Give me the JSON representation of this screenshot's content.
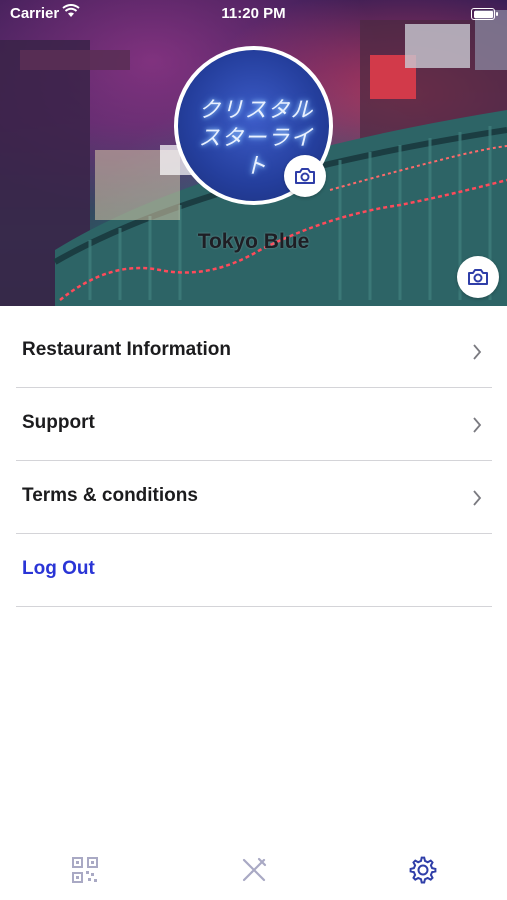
{
  "status_bar": {
    "carrier": "Carrier",
    "time": "11:20 PM"
  },
  "profile": {
    "name": "Tokyo Blue",
    "avatar_sign_text": "クリスタル スターライト"
  },
  "menu": {
    "items": [
      {
        "label": "Restaurant Information",
        "icon": "chevron-right-icon"
      },
      {
        "label": "Support",
        "icon": "chevron-right-icon"
      },
      {
        "label": "Terms & conditions",
        "icon": "chevron-right-icon"
      }
    ],
    "logout_label": "Log Out"
  },
  "tabbar": {
    "tabs": [
      {
        "icon": "qr-code-icon",
        "active": false
      },
      {
        "icon": "fork-knife-icon",
        "active": false
      },
      {
        "icon": "gear-icon",
        "active": true
      }
    ]
  },
  "colors": {
    "accent": "#2a35d6",
    "active_tab": "#2f3ea8",
    "inactive_tab": "#a9a9c4",
    "divider": "#d4d4d8"
  }
}
